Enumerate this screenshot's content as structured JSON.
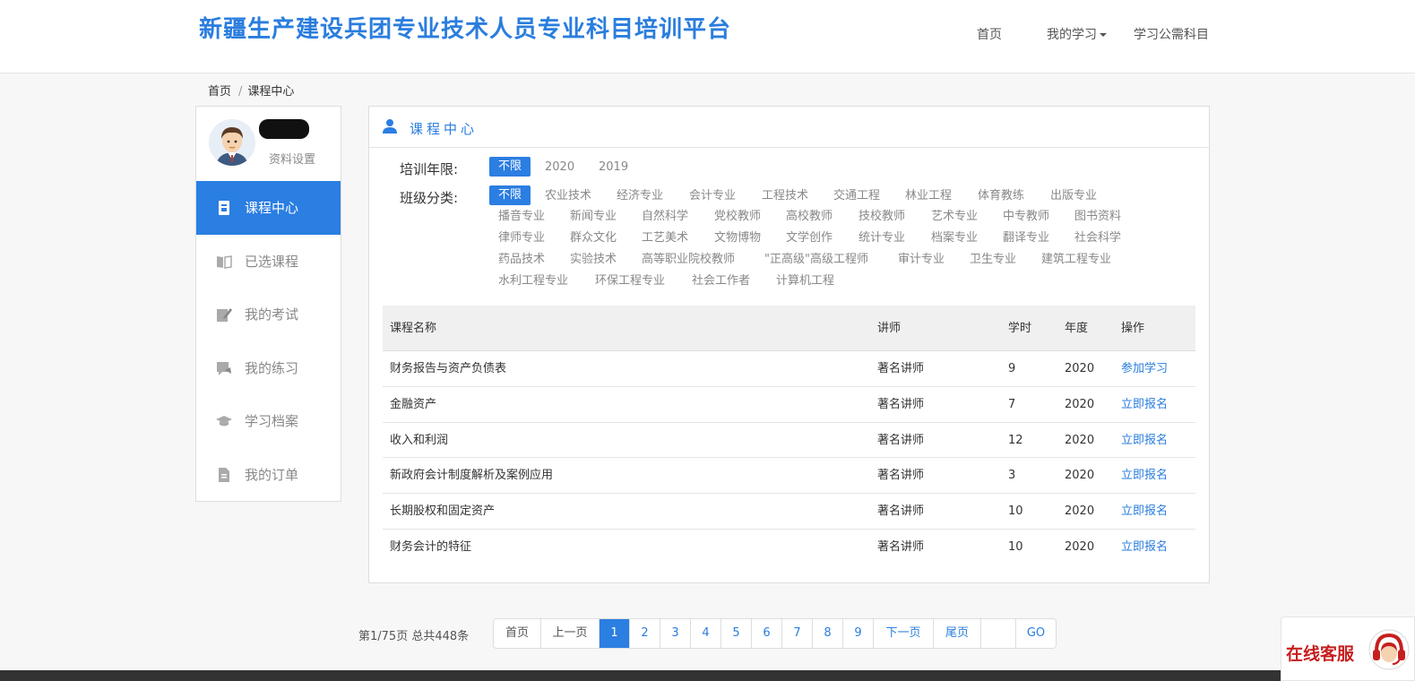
{
  "header": {
    "site_title": "新疆生产建设兵团专业技术人员专业科目培训平台",
    "nav": {
      "home": "首页",
      "my_study": "我的学习",
      "public_subjects": "学习公需科目"
    }
  },
  "breadcrumb": {
    "home": "首页",
    "sep": "/",
    "current": "课程中心"
  },
  "sidebar": {
    "profile_settings": "资料设置",
    "items": [
      {
        "label": "课程中心",
        "icon": "course-book-icon",
        "active": true
      },
      {
        "label": "已选课程",
        "icon": "open-book-icon",
        "active": false
      },
      {
        "label": "我的考试",
        "icon": "exam-edit-icon",
        "active": false
      },
      {
        "label": "我的练习",
        "icon": "practice-chat-icon",
        "active": false
      },
      {
        "label": "学习档案",
        "icon": "graduation-cap-icon",
        "active": false
      },
      {
        "label": "我的订单",
        "icon": "order-document-icon",
        "active": false
      }
    ]
  },
  "panel": {
    "title": "课程中心",
    "year_label": "培训年限:",
    "years": [
      "不限",
      "2020",
      "2019"
    ],
    "class_label": "班级分类:",
    "class_rows": [
      [
        "不限",
        "农业技术",
        "经济专业",
        "会计专业",
        "工程技术",
        "交通工程",
        "林业工程",
        "体育教练",
        "出版专业"
      ],
      [
        "播音专业",
        "新闻专业",
        "自然科学",
        "党校教师",
        "高校教师",
        "技校教师",
        "艺术专业",
        "中专教师",
        "图书资料"
      ],
      [
        "律师专业",
        "群众文化",
        "工艺美术",
        "文物博物",
        "文学创作",
        "统计专业",
        "档案专业",
        "翻译专业",
        "社会科学"
      ],
      [
        "药品技术",
        "实验技术",
        "高等职业院校教师",
        "\"正高级\"高级工程师",
        "审计专业",
        "卫生专业",
        "建筑工程专业"
      ],
      [
        "水利工程专业",
        "环保工程专业",
        "社会工作者",
        "计算机工程"
      ]
    ]
  },
  "table": {
    "headers": {
      "name": "课程名称",
      "teacher": "讲师",
      "hours": "学时",
      "year": "年度",
      "op": "操作"
    },
    "rows": [
      {
        "name": "财务报告与资产负债表",
        "teacher": "著名讲师",
        "hours": "9",
        "year": "2020",
        "op": "参加学习"
      },
      {
        "name": "金融资产",
        "teacher": "著名讲师",
        "hours": "7",
        "year": "2020",
        "op": "立即报名"
      },
      {
        "name": "收入和利润",
        "teacher": "著名讲师",
        "hours": "12",
        "year": "2020",
        "op": "立即报名"
      },
      {
        "name": "新政府会计制度解析及案例应用",
        "teacher": "著名讲师",
        "hours": "3",
        "year": "2020",
        "op": "立即报名"
      },
      {
        "name": "长期股权和固定资产",
        "teacher": "著名讲师",
        "hours": "10",
        "year": "2020",
        "op": "立即报名"
      },
      {
        "name": "财务会计的特征",
        "teacher": "著名讲师",
        "hours": "10",
        "year": "2020",
        "op": "立即报名"
      }
    ]
  },
  "pagination": {
    "info": "第1/75页 总共448条",
    "first": "首页",
    "prev": "上一页",
    "pages": [
      "1",
      "2",
      "3",
      "4",
      "5",
      "6",
      "7",
      "8",
      "9"
    ],
    "current_page": "1",
    "next": "下一页",
    "last": "尾页",
    "jump_value": "",
    "go": "GO"
  },
  "support": {
    "label": "在线客服"
  },
  "colors": {
    "accent": "#2b7ee2",
    "title_blue": "#2a7dde",
    "support_red": "#c61f1f"
  }
}
